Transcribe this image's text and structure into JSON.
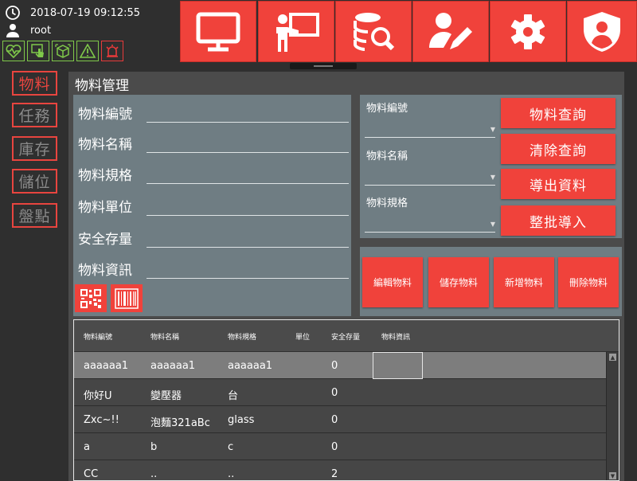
{
  "header": {
    "datetime": "2018-07-19 09:12:55",
    "user": "root",
    "status_icons": [
      "heartbeat-icon",
      "touch-icon",
      "box-scan-icon",
      "warning-icon",
      "alarm-icon"
    ],
    "nav_buttons": [
      "monitor-icon",
      "presentation-icon",
      "database-search-icon",
      "user-edit-icon",
      "gear-icon",
      "user-shield-icon"
    ]
  },
  "colors": {
    "accent": "#f0423b",
    "panel": "#6f7d83",
    "background": "#2f2f2f",
    "main": "#4b4b4b",
    "status_green": "#7fc84a"
  },
  "sidebar": {
    "items": [
      {
        "label": "物料",
        "active": true
      },
      {
        "label": "任務",
        "active": false
      },
      {
        "label": "庫存",
        "active": false
      },
      {
        "label": "儲位",
        "active": false
      },
      {
        "label": "盤點",
        "active": false
      }
    ]
  },
  "main": {
    "title": "物料管理",
    "form": {
      "fields": [
        {
          "label": "物料編號",
          "value": ""
        },
        {
          "label": "物料名稱",
          "value": ""
        },
        {
          "label": "物料規格",
          "value": ""
        },
        {
          "label": "物料單位",
          "value": ""
        },
        {
          "label": "安全存量",
          "value": ""
        },
        {
          "label": "物料資訊",
          "value": ""
        }
      ],
      "code_buttons": [
        "qr-code-icon",
        "barcode-icon"
      ]
    },
    "search": {
      "fields": [
        {
          "label": "物料編號",
          "value": ""
        },
        {
          "label": "物料名稱",
          "value": ""
        },
        {
          "label": "物料規格",
          "value": ""
        }
      ],
      "buttons": [
        "物料查詢",
        "清除查詢",
        "導出資料",
        "整批導入"
      ]
    },
    "actions": [
      "編輯物料",
      "儲存物料",
      "新增物料",
      "刪除物料"
    ],
    "table": {
      "columns": [
        "物料編號",
        "物料名稱",
        "物料規格",
        "單位",
        "安全存量",
        "物料資訊"
      ],
      "rows": [
        [
          "aaaaaa1",
          "aaaaaa1",
          "aaaaaa1",
          "",
          "0",
          ""
        ],
        [
          "你好U",
          "變壓器",
          "台",
          "",
          "0",
          ""
        ],
        [
          "Zxc~!!",
          "泡麵321aBc",
          "glass",
          "",
          "0",
          ""
        ],
        [
          "a",
          "b",
          "c",
          "",
          "0",
          ""
        ],
        [
          "CC",
          "..",
          "..",
          "",
          "2",
          ""
        ]
      ]
    }
  }
}
